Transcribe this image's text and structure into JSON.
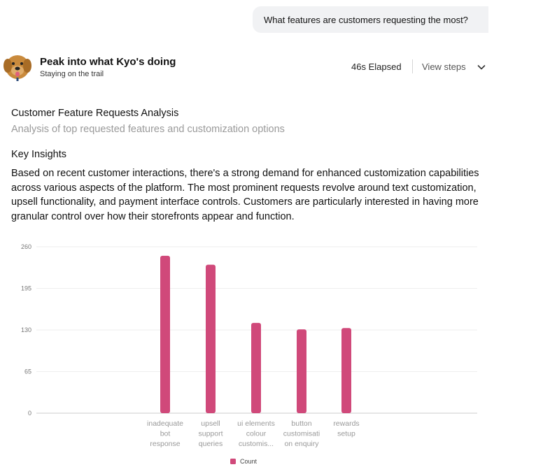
{
  "user_message": "What features are customers requesting the most?",
  "agent": {
    "title": "Peak into what Kyo's doing",
    "subtitle": "Staying on the trail",
    "avatar_icon": "dog-avatar-icon",
    "elapsed": "46s Elapsed",
    "view_steps": "View steps"
  },
  "report": {
    "title": "Customer Feature Requests Analysis",
    "subtitle": "Analysis of top requested features and customization options",
    "section_heading": "Key Insights",
    "insight_text": "Based on recent customer interactions, there's a strong demand for enhanced customization capabilities across various aspects of the platform. The most prominent requests revolve around text customization, upsell functionality, and payment interface controls. Customers are particularly interested in having more granular control over how their storefronts appear and function."
  },
  "chart_data": {
    "type": "bar",
    "categories": [
      [
        "inadequate",
        "bot",
        "response"
      ],
      [
        "upsell",
        "support",
        "queries"
      ],
      [
        "ui elements",
        "colour",
        "customis..."
      ],
      [
        "button",
        "customisati",
        "on enquiry"
      ],
      [
        "rewards",
        "setup"
      ]
    ],
    "series": [
      {
        "name": "Count",
        "values": [
          246,
          232,
          141,
          131,
          133
        ],
        "color": "#d0497a"
      }
    ],
    "ylim": [
      0,
      260
    ],
    "yticks": [
      "0",
      "65",
      "130",
      "195",
      "260"
    ],
    "grid": true,
    "legend": "bottom"
  },
  "colors": {
    "bar": "#d0497a",
    "bubble_bg": "#f1f2f4"
  }
}
